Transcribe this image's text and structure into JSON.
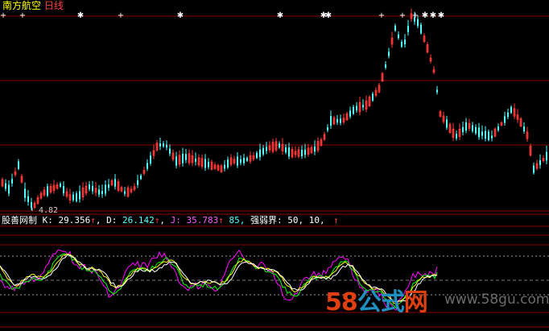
{
  "header": {
    "stock_name": "南方航空",
    "period": "日线"
  },
  "price_panel": {
    "low_label": "4.82"
  },
  "indicator": {
    "name": "股善网制",
    "k_label": "K:",
    "k_value": "29.356",
    "d_label": "D:",
    "d_value": "26.142",
    "j_label": "J:",
    "j_value": "35.783",
    "level_85": "85,",
    "strength_label": "强弱界:",
    "strength_values": "50, 10,",
    "up_arrow": "↑"
  },
  "watermark": {
    "logo_58": "58",
    "logo_gongshi": "公式",
    "logo_wang": "网",
    "url": "www.58gu.com"
  },
  "colors": {
    "background": "#000000",
    "up": "#ff3c3c",
    "down": "#54ffff",
    "grid": "#8b0000",
    "k_line": "#ffffff",
    "d_line": "#ffff00",
    "j_line": "#ff00ff",
    "green_line": "#00ff00",
    "title_yellow": "#ffff00",
    "period_red": "#ff4040",
    "label_white": "#ffffff",
    "k_color": "#ffffff",
    "d_color": "#54ffff",
    "j_color": "#ff55ff",
    "v85_color": "#54ffff",
    "watermark_58": "#e04010",
    "watermark_gongshi": "#1f8fc0",
    "watermark_wang": "#e04010"
  }
}
